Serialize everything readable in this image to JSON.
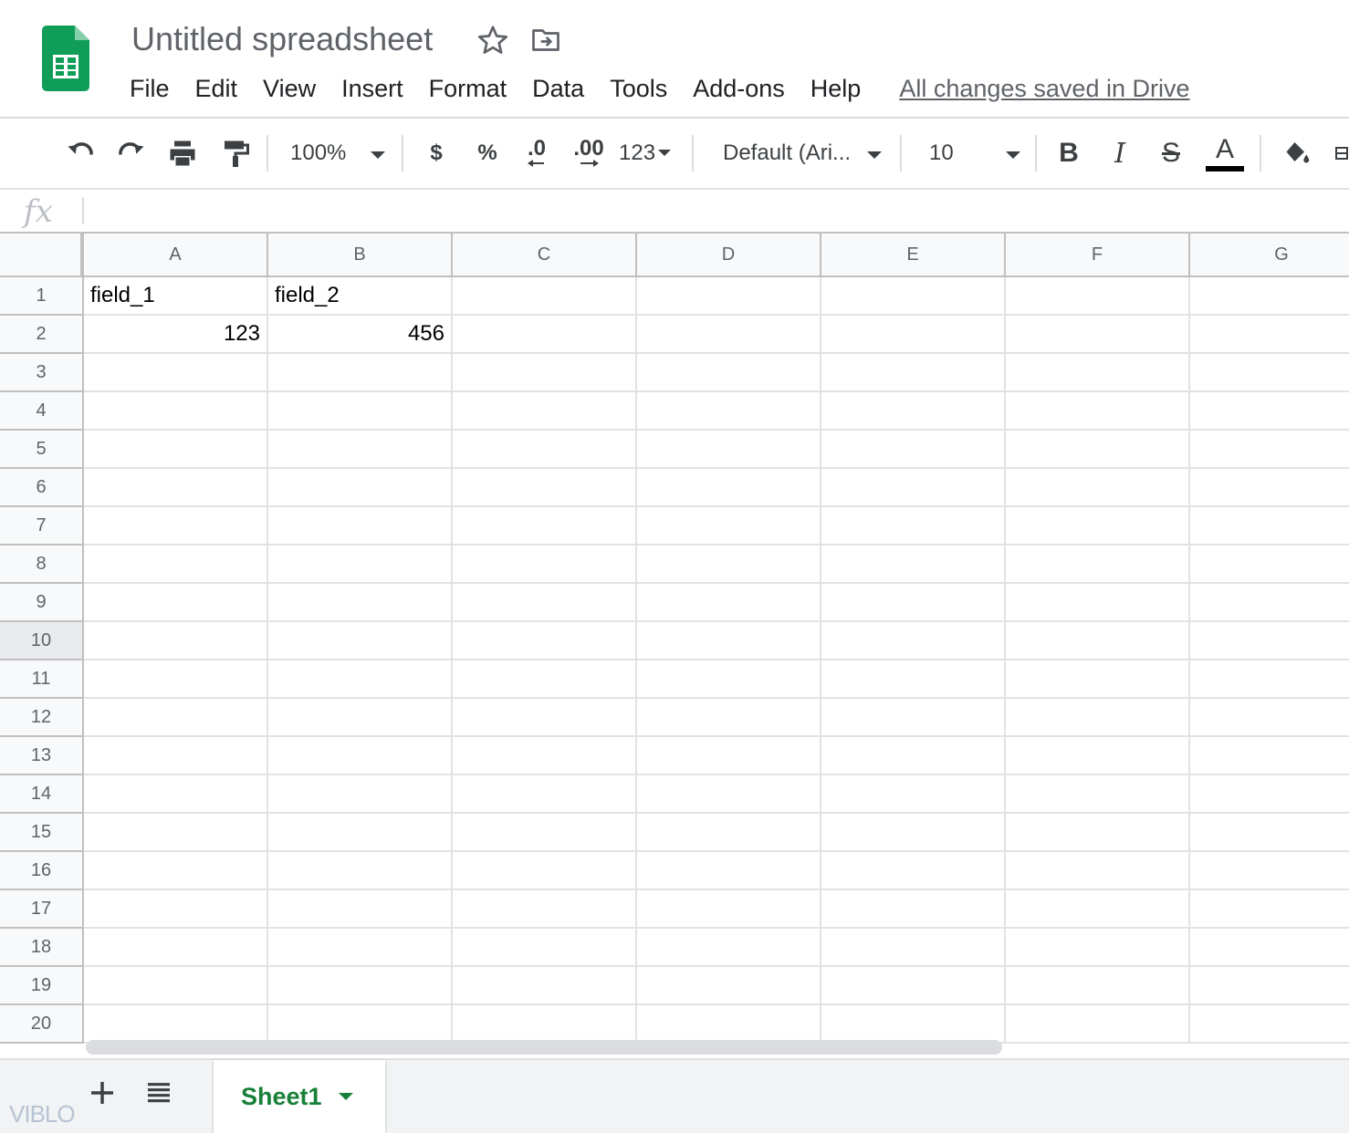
{
  "document": {
    "title": "Untitled spreadsheet",
    "save_status": "All changes saved in Drive"
  },
  "menu": [
    "File",
    "Edit",
    "View",
    "Insert",
    "Format",
    "Data",
    "Tools",
    "Add-ons",
    "Help"
  ],
  "toolbar": {
    "zoom": "100%",
    "currency_label": "$",
    "percent_label": "%",
    "decrease_decimal_label": ".0",
    "increase_decimal_label": ".00",
    "number_format_label": "123",
    "font_family": "Default (Ari...",
    "font_size": "10",
    "bold_label": "B",
    "italic_label": "I",
    "strike_label": "S",
    "text_color_label": "A"
  },
  "formula_bar": {
    "fx_label": "fx",
    "value": ""
  },
  "columns": [
    "A",
    "B",
    "C",
    "D",
    "E",
    "F",
    "G"
  ],
  "rows": [
    "1",
    "2",
    "3",
    "4",
    "5",
    "6",
    "7",
    "8",
    "9",
    "10",
    "11",
    "12",
    "13",
    "14",
    "15",
    "16",
    "17",
    "18",
    "19",
    "20"
  ],
  "highlighted_row": "10",
  "cells": {
    "A1": "field_1",
    "B1": "field_2",
    "A2": "123",
    "B2": "456"
  },
  "sheets": {
    "active": "Sheet1"
  },
  "watermark": "VIBLO",
  "colors": {
    "brand_green": "#188038",
    "logo_green": "#0f9d58",
    "grid_line": "#e2e2e2",
    "header_bg": "#f8f9fa"
  }
}
